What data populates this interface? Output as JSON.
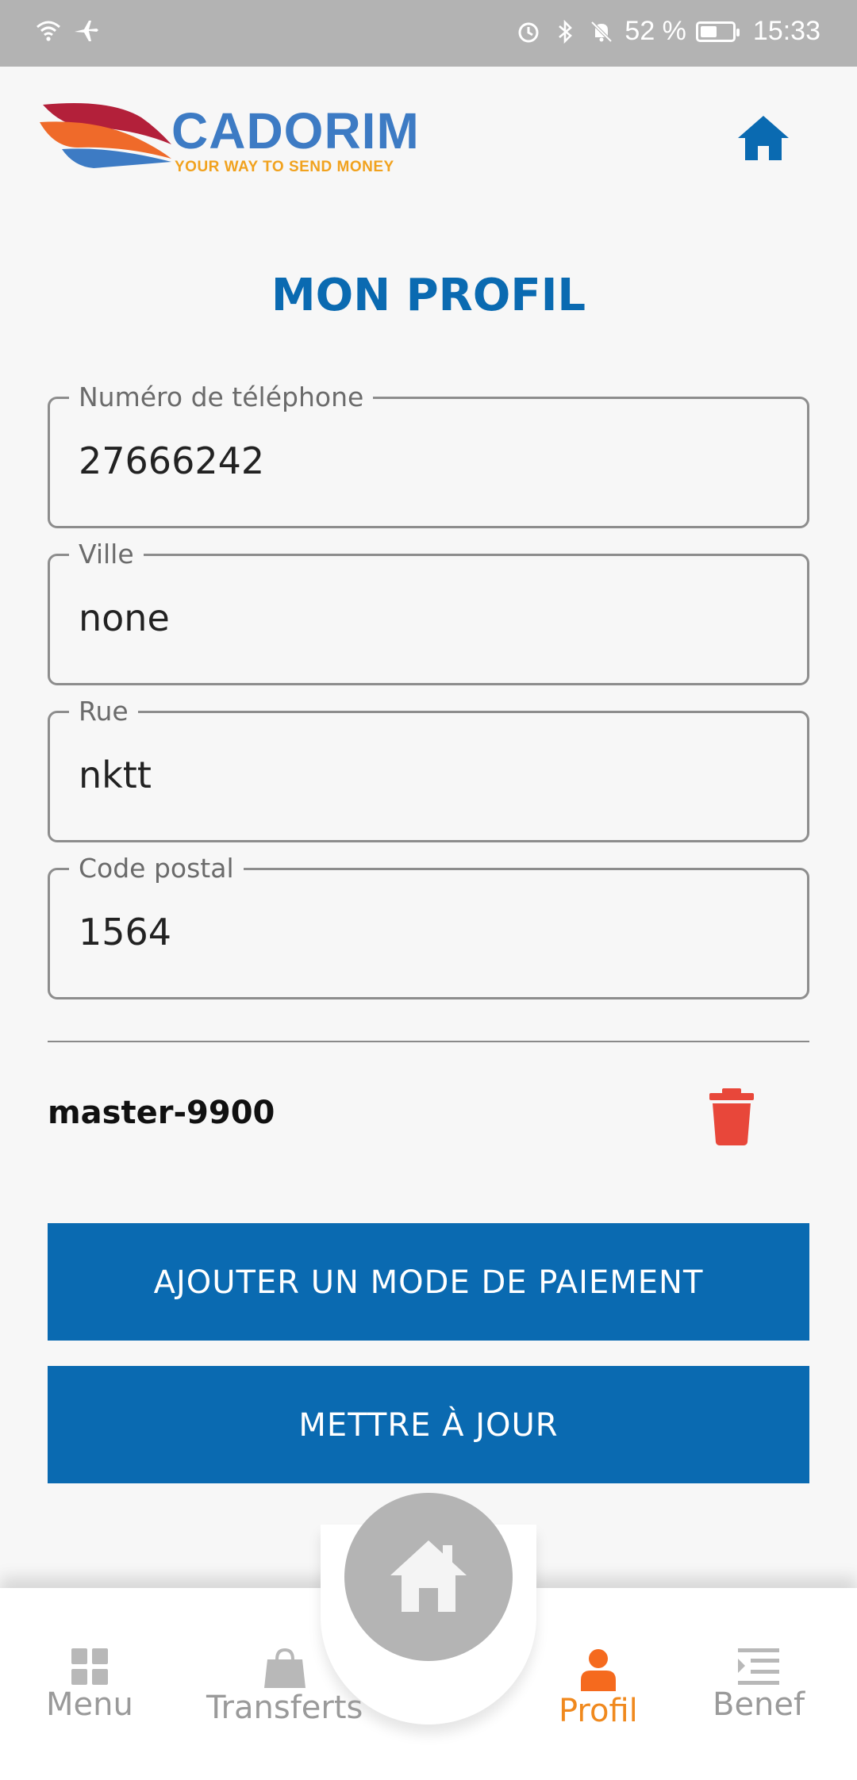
{
  "status_bar": {
    "battery": "52 %",
    "time": "15:33"
  },
  "header": {
    "brand": "CADORIM",
    "tagline": "YOUR WAY TO SEND MONEY"
  },
  "page_title": "MON PROFIL",
  "fields": [
    {
      "label": "Numéro de téléphone",
      "value": "27666242"
    },
    {
      "label": "Ville",
      "value": "none"
    },
    {
      "label": "Rue",
      "value": "nktt"
    },
    {
      "label": "Code postal",
      "value": "1564"
    }
  ],
  "payment_method": {
    "label": "master-9900"
  },
  "buttons": {
    "add_payment": "AJOUTER UN MODE DE PAIEMENT",
    "update": "METTRE À JOUR"
  },
  "bottom_nav": {
    "items": [
      {
        "label": "Menu",
        "icon": "grid-icon"
      },
      {
        "label": "Transferts",
        "icon": "bag-icon"
      },
      {
        "label": "Profil",
        "icon": "person-icon",
        "active": true
      },
      {
        "label": "Benef",
        "icon": "list-icon"
      }
    ],
    "center_icon": "home-icon"
  },
  "colors": {
    "primary": "#0a6ab1",
    "accent_orange": "#f0891e",
    "danger": "#e8473a"
  }
}
